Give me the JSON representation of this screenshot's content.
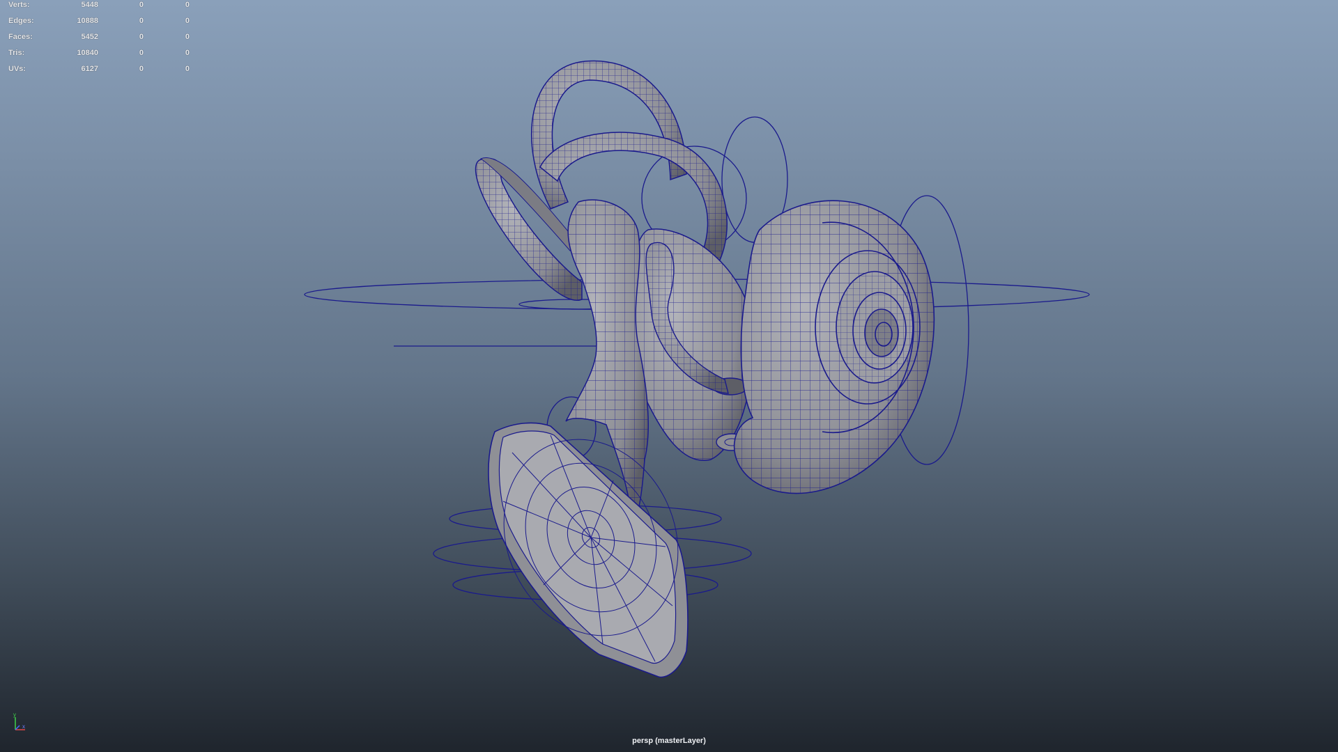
{
  "hud": {
    "rows": [
      {
        "label": "Verts:",
        "v1": "5448",
        "v2": "0",
        "v3": "0"
      },
      {
        "label": "Edges:",
        "v1": "10888",
        "v2": "0",
        "v3": "0"
      },
      {
        "label": "Faces:",
        "v1": "5452",
        "v2": "0",
        "v3": "0"
      },
      {
        "label": "Tris:",
        "v1": "10840",
        "v2": "0",
        "v3": "0"
      },
      {
        "label": "UVs:",
        "v1": "6127",
        "v2": "0",
        "v3": "0"
      }
    ]
  },
  "camera_label": "persp (masterLayer)",
  "axis": {
    "y": "y",
    "x": "x"
  },
  "colors": {
    "wire": "#1a1a8c",
    "mesh_fill": "#9fa0a6",
    "mesh_shade": "#6f7078",
    "bg_top": "#8aa0ba",
    "bg_bottom": "#1f252d"
  }
}
